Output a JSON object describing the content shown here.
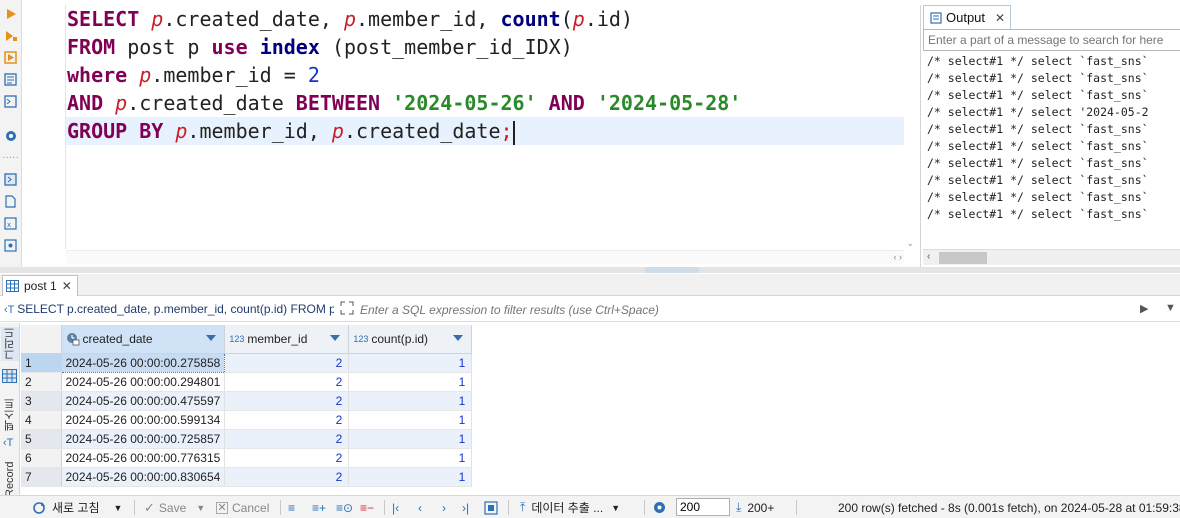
{
  "editor": {
    "lines": [
      [
        {
          "t": "SELECT ",
          "c": "kw"
        },
        {
          "t": "p",
          "c": "alias"
        },
        {
          "t": ".created_date, ",
          "c": ""
        },
        {
          "t": "p",
          "c": "alias"
        },
        {
          "t": ".member_id, ",
          "c": ""
        },
        {
          "t": "count",
          "c": "kwb"
        },
        {
          "t": "(",
          "c": ""
        },
        {
          "t": "p",
          "c": "alias"
        },
        {
          "t": ".id)",
          "c": ""
        }
      ],
      [
        {
          "t": "FROM ",
          "c": "kw"
        },
        {
          "t": "post p ",
          "c": ""
        },
        {
          "t": "use ",
          "c": "kw"
        },
        {
          "t": "index ",
          "c": "kwb"
        },
        {
          "t": "(post_member_id_IDX)",
          "c": ""
        }
      ],
      [
        {
          "t": "where ",
          "c": "kw"
        },
        {
          "t": "p",
          "c": "alias"
        },
        {
          "t": ".member_id = ",
          "c": ""
        },
        {
          "t": "2",
          "c": "num"
        }
      ],
      [
        {
          "t": "AND ",
          "c": "kw"
        },
        {
          "t": "p",
          "c": "alias"
        },
        {
          "t": ".created_date ",
          "c": ""
        },
        {
          "t": "BETWEEN ",
          "c": "kw"
        },
        {
          "t": "'2024-05-26'",
          "c": "str"
        },
        {
          "t": " AND ",
          "c": "kw"
        },
        {
          "t": "'2024-05-28'",
          "c": "str"
        }
      ],
      [
        {
          "t": "GROUP BY ",
          "c": "kw"
        },
        {
          "t": "p",
          "c": "alias"
        },
        {
          "t": ".member_id, ",
          "c": ""
        },
        {
          "t": "p",
          "c": "alias"
        },
        {
          "t": ".created_date",
          "c": ""
        },
        {
          "t": ";",
          "c": "semi"
        }
      ]
    ],
    "current_line": 4
  },
  "output": {
    "tab_label": "Output",
    "search_placeholder": "Enter a part of a message to search for here",
    "lines": [
      "/* select#1 */ select `fast_sns`",
      "/* select#1 */ select `fast_sns`",
      "/* select#1 */ select `fast_sns`",
      "/* select#1 */ select '2024-05-2",
      "/* select#1 */ select `fast_sns`",
      "/* select#1 */ select `fast_sns`",
      "/* select#1 */ select `fast_sns`",
      "/* select#1 */ select `fast_sns`",
      "/* select#1 */ select `fast_sns`",
      "/* select#1 */ select `fast_sns`"
    ]
  },
  "results": {
    "tab_label": "post 1",
    "filter_sql": "SELECT p.created_date, p.member_id, count(p.id) FROM p",
    "filter_placeholder": "Enter a SQL expression to filter results (use Ctrl+Space)",
    "side_tabs": [
      "그리드",
      "텍스트",
      "Record"
    ],
    "columns": [
      {
        "name": "created_date",
        "type_icon": "clock-icon"
      },
      {
        "name": "member_id",
        "type_icon": "123"
      },
      {
        "name": "count(p.id)",
        "type_icon": "123"
      }
    ],
    "rows": [
      [
        "1",
        "2024-05-26 00:00:00.275858",
        "2",
        "1"
      ],
      [
        "2",
        "2024-05-26 00:00:00.294801",
        "2",
        "1"
      ],
      [
        "3",
        "2024-05-26 00:00:00.475597",
        "2",
        "1"
      ],
      [
        "4",
        "2024-05-26 00:00:00.599134",
        "2",
        "1"
      ],
      [
        "5",
        "2024-05-26 00:00:00.725857",
        "2",
        "1"
      ],
      [
        "6",
        "2024-05-26 00:00:00.776315",
        "2",
        "1"
      ],
      [
        "7",
        "2024-05-26 00:00:00.830654",
        "2",
        "1"
      ]
    ]
  },
  "statusbar": {
    "refresh_label": "새로 고침",
    "save_label": "Save",
    "cancel_label": "Cancel",
    "export_label": "데이터 추출 ...",
    "fetch_size": "200",
    "fetch_more_label": "200+",
    "status_text": "200 row(s) fetched - 8s (0.001s fetch), on 2024-05-28 at 01:59:38"
  },
  "colors": {
    "accent": "#2f6fb3",
    "keyword": "#7f0055",
    "string": "#2a8a2a",
    "alias": "#c81e28",
    "number": "#1a33c8"
  }
}
